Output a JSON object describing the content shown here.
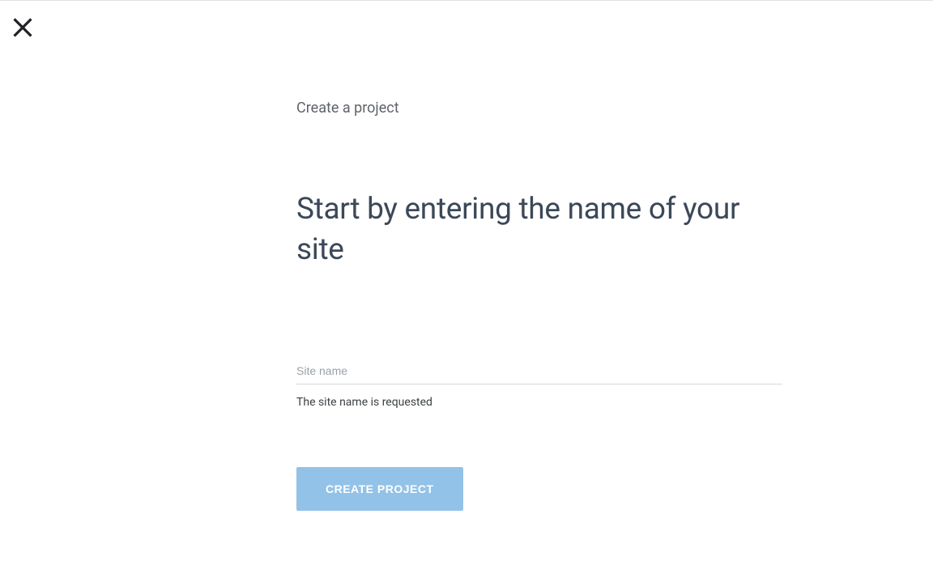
{
  "breadcrumb": "Create a project",
  "heading": "Start by entering the name of your site",
  "form": {
    "site_name_placeholder": "Site name",
    "site_name_value": "",
    "helper_text": "The site name is requested",
    "submit_label": "CREATE PROJECT"
  }
}
